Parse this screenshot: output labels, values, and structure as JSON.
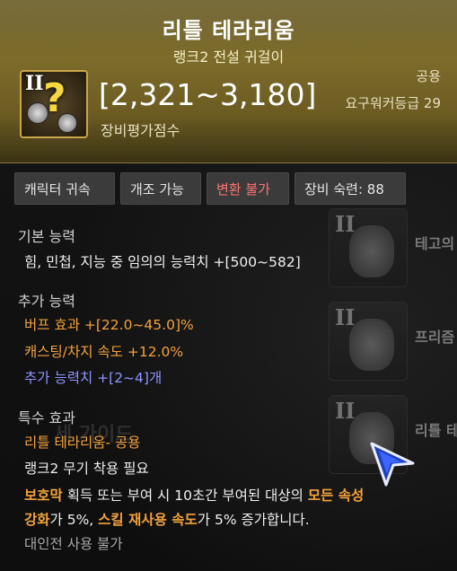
{
  "item": {
    "name": "리틀 테라리움",
    "subtitle": "랭크2 전설 귀걸이",
    "rank_numeral": "II",
    "score": "[2,321~3,180]",
    "score_label": "장비평가점수",
    "share": "공용",
    "required_level": "요구워커등급 29",
    "header_color": "#6c5c22",
    "icon": "question-mark-earring-icon"
  },
  "tags": [
    {
      "label": "캐릭터 귀속",
      "color": "#e6e6e6"
    },
    {
      "label": "개조 가능",
      "color": "#e6e6e6"
    },
    {
      "label": "변환 불가",
      "color": "#ff7474"
    },
    {
      "label": "장비 숙련: 88",
      "color": "#e6e6e6"
    }
  ],
  "basic": {
    "title": "기본 능력",
    "line1": "힘, 민첩, 지능 중 임의의 능력치 +[500~582]"
  },
  "extra": {
    "title": "추가 능력",
    "line1": "버프 효과  +[22.0~45.0]%",
    "line2": "캐스팅/차지 속도  +12.0%",
    "line3": "추가 능력치 +[2~4]개",
    "line1_color": "#f4a23c",
    "line3_color": "#8f93ff"
  },
  "special": {
    "title": "특수 효과",
    "line1": "리틀 테라리움- 공용",
    "line2": "랭크2 무기 착용 필요",
    "line3_p1": "보호막",
    "line3_p2": " 획득 또는 부여 시 10초간 부여된 대상의 ",
    "line3_p3": "모든 속성",
    "line4_p1": "강화",
    "line4_p2": "가 5%, ",
    "line4_p3": "스킬 재사용 속도",
    "line4_p4": "가 5% 증가합니다.",
    "line5": "대인전 사용 불가"
  },
  "background_list": [
    {
      "rank": "II",
      "label": "테고의"
    },
    {
      "rank": "II",
      "label": "프리즘"
    },
    {
      "rank": "II",
      "label": "리틀 테"
    }
  ],
  "bg_text": "세 가이드",
  "cursor": "arrow-cursor-icon"
}
